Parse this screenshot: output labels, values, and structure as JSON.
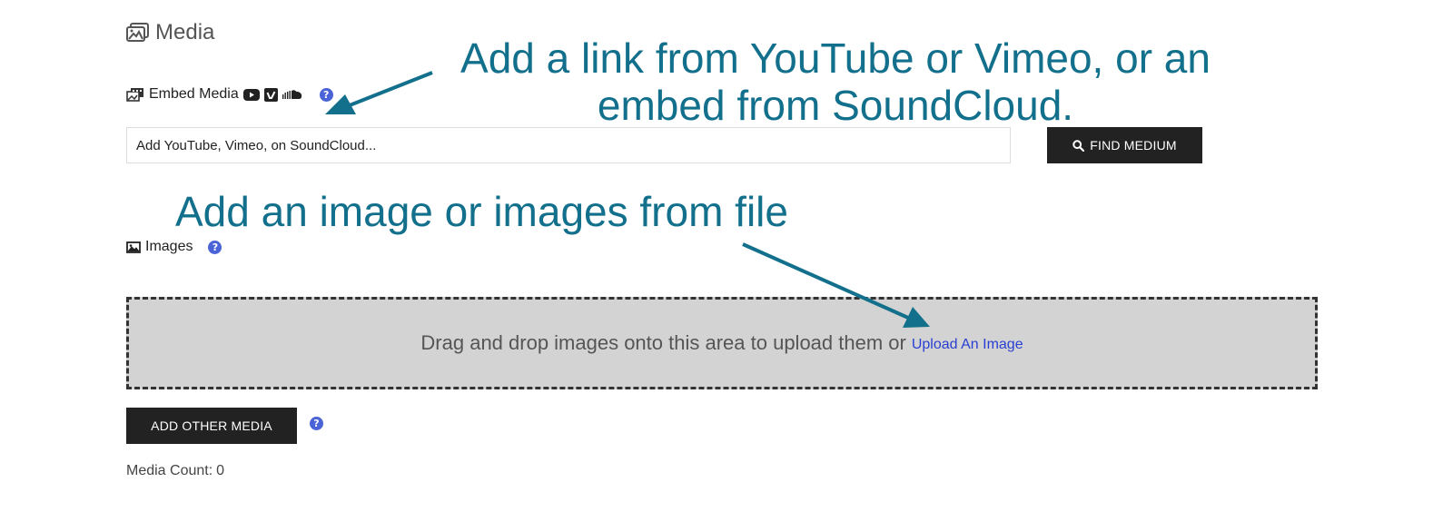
{
  "section": {
    "title": "Media",
    "icon": "images-icon"
  },
  "embed": {
    "label": "Embed Media",
    "service_icons": [
      "youtube-icon",
      "vimeo-icon",
      "soundcloud-icon"
    ],
    "input_value": "",
    "input_placeholder": "Add YouTube, Vimeo, on SoundCloud...",
    "find_button_label": "FIND MEDIUM",
    "help_icon": "?"
  },
  "images": {
    "label": "Images",
    "help_icon": "?",
    "dropzone_text": "Drag and drop images onto this area to upload them or",
    "upload_link": "Upload An Image"
  },
  "other_media": {
    "button_label": "ADD OTHER MEDIA",
    "help_icon": "?"
  },
  "media_count": {
    "label": "Media Count:",
    "value": "0"
  },
  "annotations": {
    "embed_line1": "Add a link from YouTube or Vimeo, or an",
    "embed_line2": "embed from SoundCloud.",
    "images": "Add an image or images from file"
  },
  "colors": {
    "annotation": "#13708c",
    "button_bg": "#222222",
    "dropzone_bg": "#d3d3d3",
    "help_icon": "#4a63d6",
    "link": "#2a3fd1"
  }
}
